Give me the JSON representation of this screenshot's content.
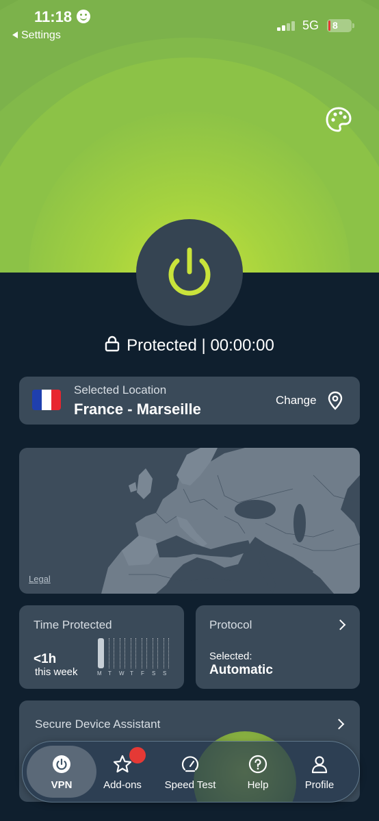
{
  "status_bar": {
    "time": "11:18",
    "back_label": "Settings",
    "network": "5G",
    "battery": "8"
  },
  "connection": {
    "status": "Protected | 00:00:00"
  },
  "location": {
    "label": "Selected Location",
    "value": "France - Marseille",
    "change_label": "Change"
  },
  "map": {
    "legal_label": "Legal"
  },
  "time_protected": {
    "title": "Time Protected",
    "value": "<1h",
    "subtitle": "this week",
    "days": [
      "M",
      "T",
      "W",
      "T",
      "F",
      "S",
      "S"
    ]
  },
  "protocol": {
    "title": "Protocol",
    "selected_label": "Selected:",
    "value": "Automatic"
  },
  "secure_device": {
    "title": "Secure Device Assistant"
  },
  "tabs": [
    {
      "label": "VPN",
      "icon": "power-icon",
      "active": true
    },
    {
      "label": "Add-ons",
      "icon": "star-icon",
      "active": false
    },
    {
      "label": "Speed Test",
      "icon": "speedometer-icon",
      "active": false
    },
    {
      "label": "Help",
      "icon": "help-icon",
      "active": false
    },
    {
      "label": "Profile",
      "icon": "person-icon",
      "active": false
    }
  ],
  "colors": {
    "accent_green": "#c9e33b",
    "background": "#0f1f2e",
    "card": "#3a4a59",
    "badge_red": "#e53935"
  }
}
